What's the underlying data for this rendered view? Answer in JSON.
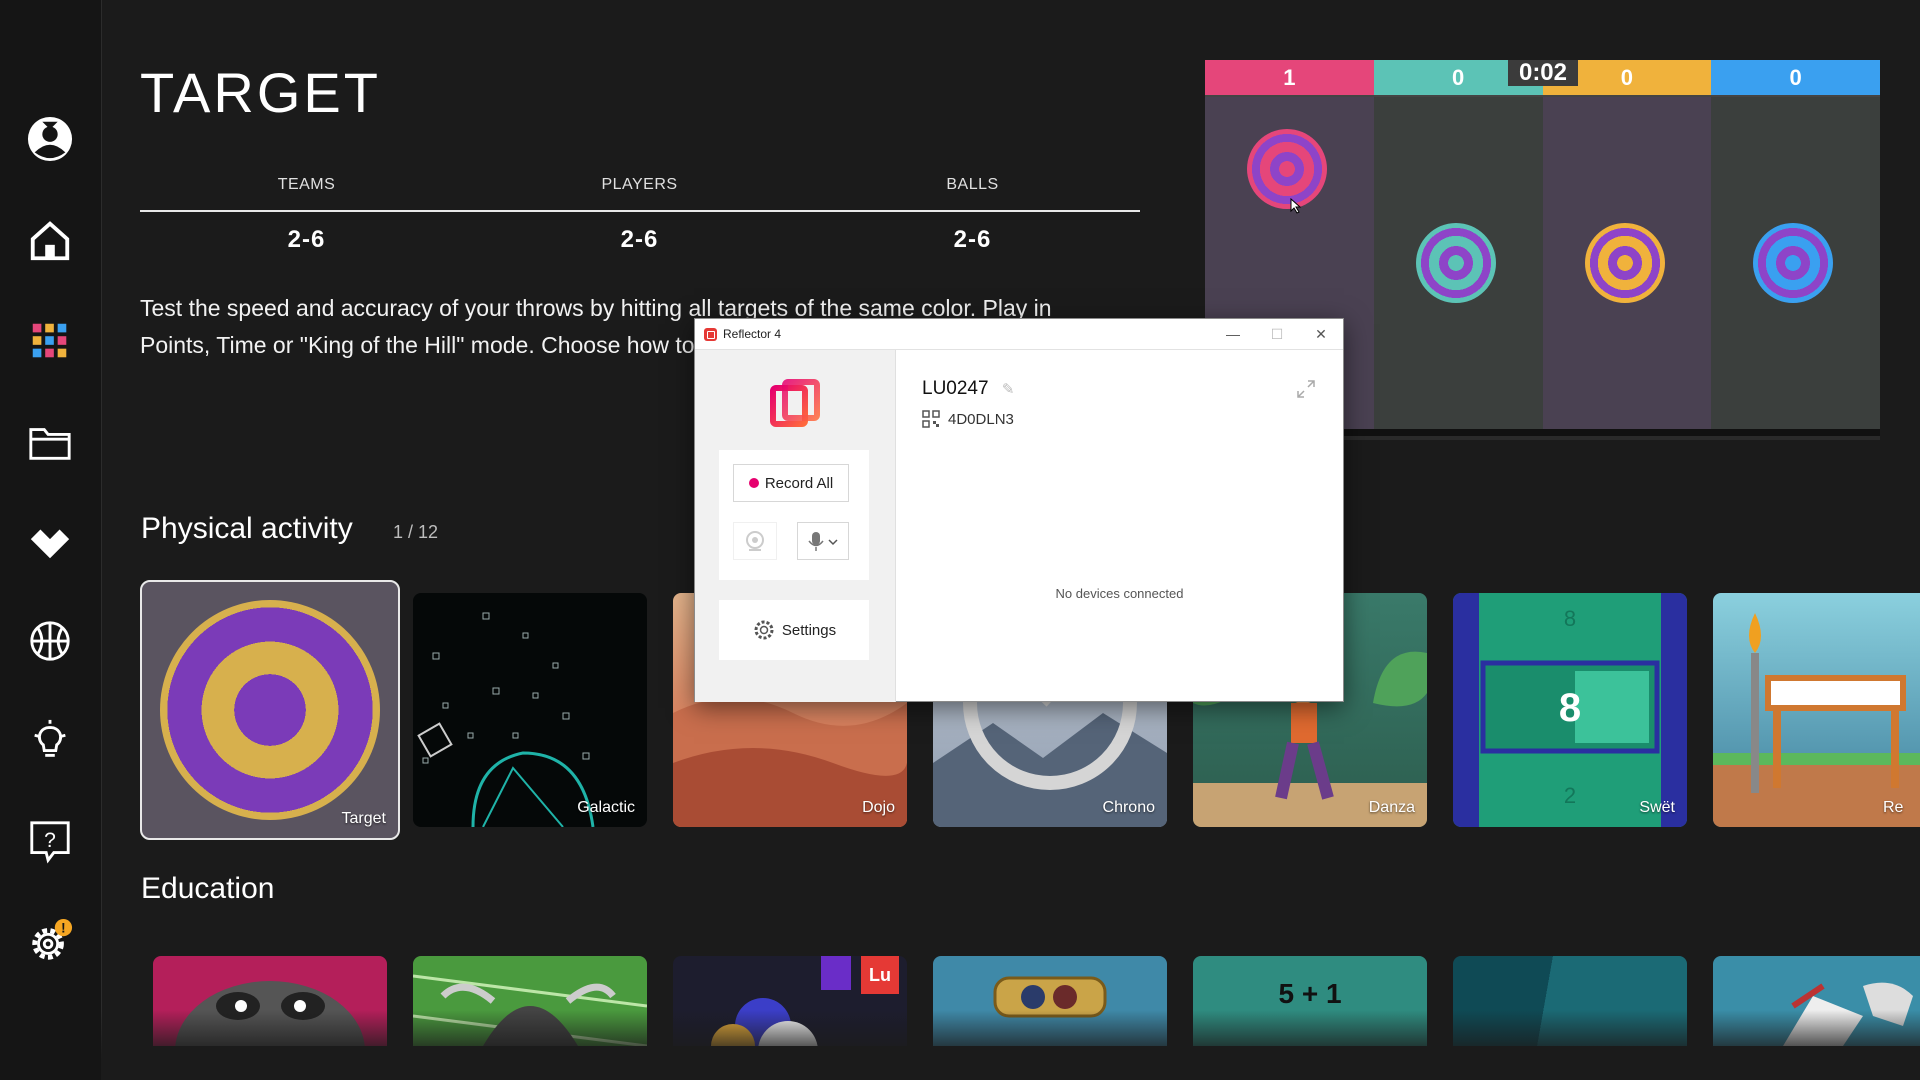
{
  "game": {
    "title": "TARGET",
    "stats": {
      "teams_label": "TEAMS",
      "teams_value": "2-6",
      "players_label": "PLAYERS",
      "players_value": "2-6",
      "balls_label": "BALLS",
      "balls_value": "2-6"
    },
    "description": "Test the speed and accuracy of your throws by hitting all targets of the same color. Play in Points, Time or \"King of the Hill\" mode. Choose how to ... difficulty as needed!"
  },
  "preview": {
    "scores": [
      "1",
      "0",
      "0",
      "0"
    ],
    "timer": "0:02",
    "team_colors": [
      "#e5467a",
      "#5cc3b6",
      "#f0b23c",
      "#3aa0f0"
    ],
    "lane_colors": [
      "#4a4152",
      "#3b3f3d",
      "#4a4152",
      "#3b3f3d"
    ],
    "ring_color": "#8e44c8"
  },
  "sections": {
    "physical": {
      "title": "Physical activity",
      "count": "1 / 12",
      "tiles": [
        {
          "label": "Target"
        },
        {
          "label": "Galactic"
        },
        {
          "label": "Dojo"
        },
        {
          "label": "Chrono"
        },
        {
          "label": "Danza"
        },
        {
          "label": "Swët"
        },
        {
          "label": "Re"
        }
      ]
    },
    "education": {
      "title": "Education",
      "math_tile_text": "5 + 1",
      "lu_badge": "Lu"
    }
  },
  "reflector": {
    "title": "Reflector 4",
    "record_all": "Record All",
    "settings": "Settings",
    "device_name": "LU0247",
    "device_code": "4D0DLN3",
    "no_devices": "No devices connected",
    "minimize": "—",
    "maximize": "☐",
    "close": "✕"
  },
  "colors": {
    "accent_gold": "#d7b04d",
    "accent_purple": "#7b3bb8",
    "record_dot": "#e6006e",
    "warning": "#f5a623"
  }
}
